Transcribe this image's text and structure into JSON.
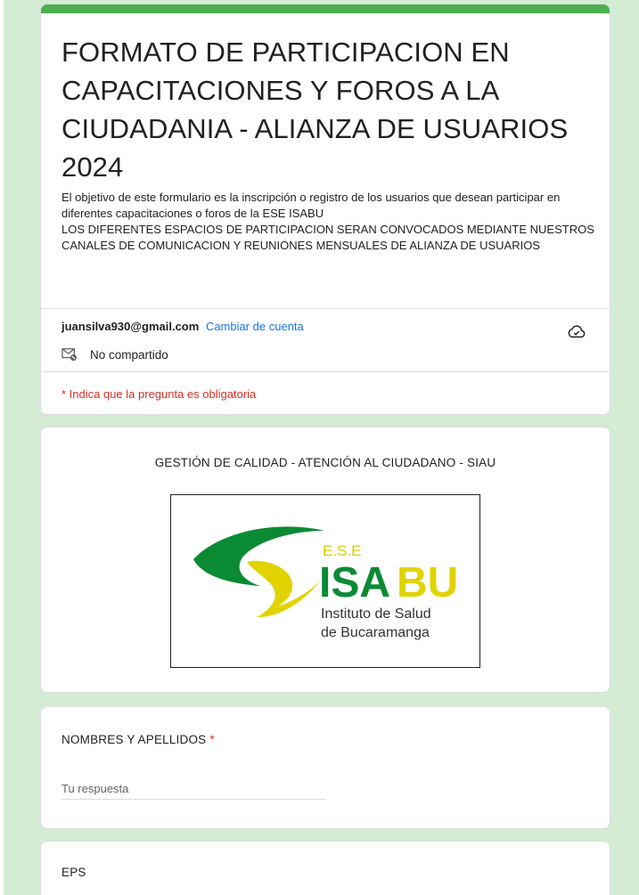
{
  "form": {
    "title": "FORMATO DE  PARTICIPACION EN CAPACITACIONES Y FOROS A LA CIUDADANIA - ALIANZA DE USUARIOS 2024",
    "description": "El objetivo de este formulario es la inscripción o registro de los usuarios que desean participar en diferentes capacitaciones o foros  de la ESE ISABU\nLOS DIFERENTES ESPACIOS DE PARTICIPACION SERAN CONVOCADOS MEDIANTE NUESTROS CANALES DE COMUNICACION Y REUNIONES MENSUALES DE ALIANZA DE USUARIOS",
    "accent_color": "#4caf50"
  },
  "account": {
    "email": "juansilva930@gmail.com",
    "switch_label": "Cambiar de cuenta",
    "not_shared_label": "No compartido",
    "cloud_icon": "cloud-check-icon"
  },
  "required_note": "* Indica que la pregunta es obligatoria",
  "logo_section": {
    "title": "GESTIÓN DE CALIDAD - ATENCIÓN AL CIUDADANO  -  SIAU",
    "logo": {
      "ese": "E.S.E",
      "isa": "ISA",
      "bu": "BU",
      "line1": "Instituto de Salud",
      "line2": "de Bucaramanga"
    }
  },
  "questions": [
    {
      "label": "NOMBRES Y APELLIDOS",
      "required_mark": "*",
      "placeholder": "Tu respuesta"
    },
    {
      "label": "EPS"
    }
  ]
}
